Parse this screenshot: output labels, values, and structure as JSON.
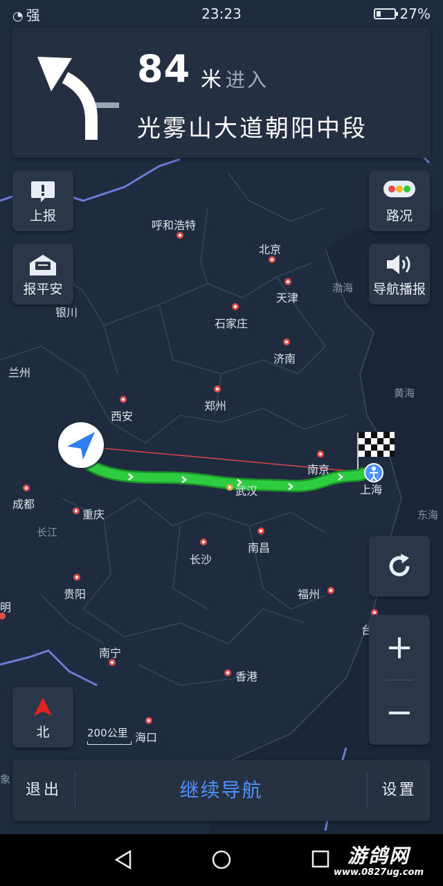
{
  "status_bar": {
    "signal": "强",
    "time": "23:23",
    "battery": "27%",
    "battery_level": 0.27
  },
  "guidance": {
    "distance": "84",
    "unit": "米",
    "action": "进入",
    "road": "光雾山大道朝阳中段"
  },
  "buttons": {
    "report": "上报",
    "safe": "报平安",
    "traffic": "路况",
    "voice": "导航播报",
    "compass": "北"
  },
  "scale": {
    "label": "200公里"
  },
  "bottom_bar": {
    "exit": "退出",
    "continue": "继续导航",
    "settings": "设置"
  },
  "map": {
    "cities": [
      "呼和浩特",
      "北京",
      "天津",
      "石家庄",
      "济南",
      "银川",
      "兰州",
      "西安",
      "郑州",
      "南京",
      "上海",
      "成都",
      "重庆",
      "武汉",
      "长沙",
      "南昌",
      "贵阳",
      "福州",
      "南宁",
      "香港",
      "海口",
      "台北",
      "明"
    ],
    "seas": [
      "渤海",
      "黄海",
      "东海",
      "长江",
      "象"
    ],
    "route_color": "#2ecc40"
  },
  "watermark": {
    "name": "游鸽网",
    "url": "www.0827ug.com"
  }
}
